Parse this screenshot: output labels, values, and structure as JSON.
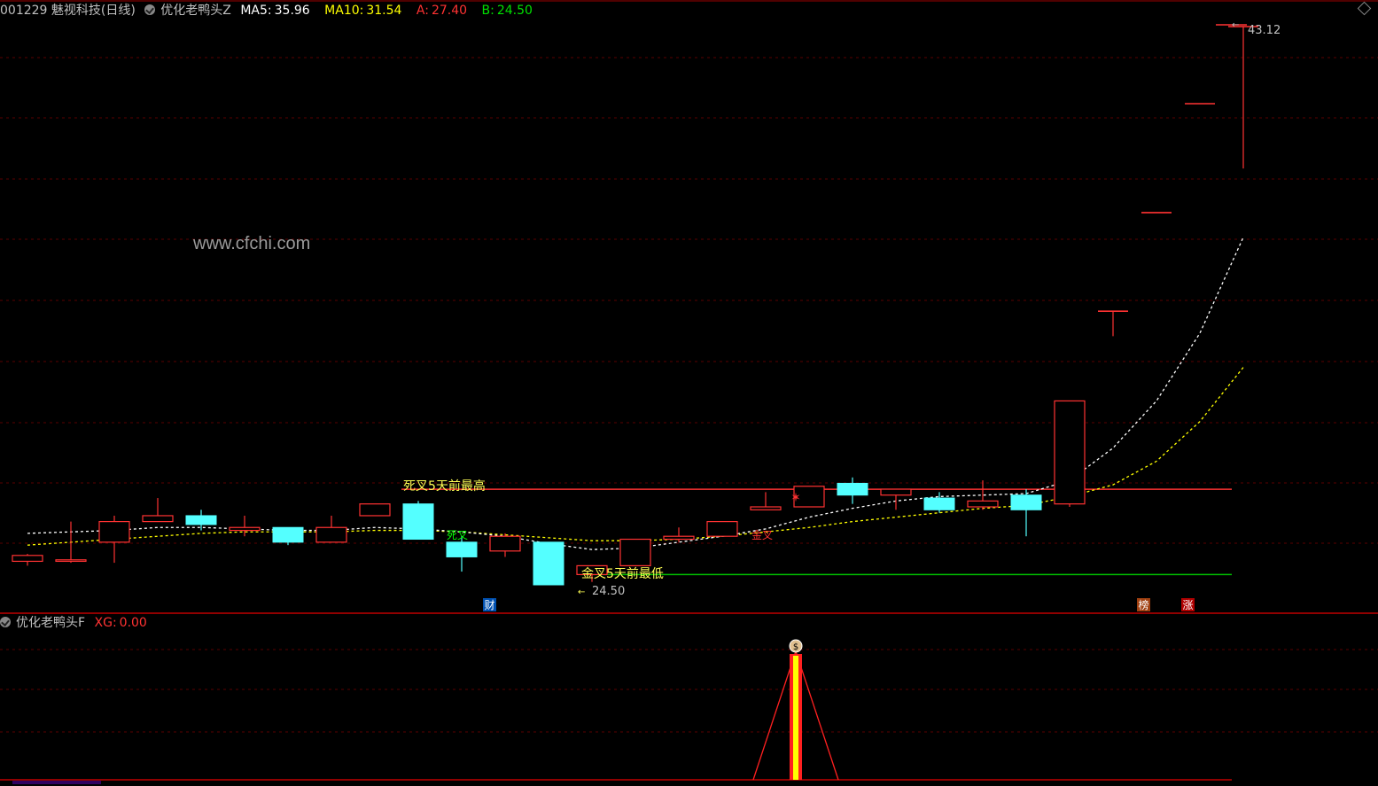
{
  "header": {
    "code_name": "001229 魅视科技",
    "period": "(日线)",
    "indicator": "优化老鸭头Z",
    "ma5_label": "MA5:",
    "ma5_value": "35.96",
    "ma10_label": "MA10:",
    "ma10_value": "31.54",
    "a_label": "A:",
    "a_value": "27.40",
    "b_label": "B:",
    "b_value": "24.50"
  },
  "sub_header": {
    "indicator": "优化老鸭头F",
    "xg_label": "XG:",
    "xg_value": "0.00"
  },
  "watermark": "www.cfchi.com",
  "annotations": {
    "death_cross_high": "死叉5天前最高",
    "golden_cross_low": "金叉5天前最低",
    "death_cross": "死叉",
    "golden_cross": "金叉",
    "low_value": "24.50",
    "high_value": "43.12",
    "badge_cai": "财",
    "badge_bang": "榜",
    "badge_zhang": "涨"
  },
  "colors": {
    "up": "#ff3232",
    "down": "#54ffff",
    "ma5": "#ffffff",
    "ma10": "#ffff00",
    "grid": "#5a0000",
    "line_a": "#ff3232",
    "line_b": "#00c000",
    "text_yellow": "#ffff54",
    "text_green": "#00ff00"
  },
  "chart_data": {
    "type": "candlestick",
    "level_a": 27.4,
    "level_b": 24.5,
    "candles": [
      {
        "o": 24.95,
        "c": 25.15,
        "h": 25.2,
        "l": 24.8
      },
      {
        "o": 24.95,
        "c": 25.0,
        "h": 26.3,
        "l": 24.9
      },
      {
        "o": 25.6,
        "c": 26.3,
        "h": 26.5,
        "l": 24.9
      },
      {
        "o": 26.3,
        "c": 26.5,
        "h": 27.1,
        "l": 26.3
      },
      {
        "o": 26.5,
        "c": 26.2,
        "h": 26.7,
        "l": 26.0
      },
      {
        "o": 26.0,
        "c": 26.1,
        "h": 26.5,
        "l": 25.8
      },
      {
        "o": 26.1,
        "c": 25.6,
        "h": 26.1,
        "l": 25.5
      },
      {
        "o": 25.6,
        "c": 26.1,
        "h": 26.5,
        "l": 25.6
      },
      {
        "o": 26.5,
        "c": 26.9,
        "h": 26.9,
        "l": 26.5
      },
      {
        "o": 26.9,
        "c": 25.7,
        "h": 27.0,
        "l": 25.7
      },
      {
        "o": 25.6,
        "c": 25.1,
        "h": 25.8,
        "l": 24.6
      },
      {
        "o": 25.3,
        "c": 25.8,
        "h": 25.9,
        "l": 25.1
      },
      {
        "o": 25.6,
        "c": 24.15,
        "h": 25.6,
        "l": 24.15
      },
      {
        "o": 24.5,
        "c": 24.8,
        "h": 24.8,
        "l": 24.25
      },
      {
        "o": 24.8,
        "c": 25.7,
        "h": 25.7,
        "l": 24.8
      },
      {
        "o": 25.7,
        "c": 25.8,
        "h": 26.1,
        "l": 25.6
      },
      {
        "o": 25.8,
        "c": 26.3,
        "h": 26.3,
        "l": 25.8
      },
      {
        "o": 26.7,
        "c": 26.8,
        "h": 27.3,
        "l": 26.7
      },
      {
        "o": 26.8,
        "c": 27.5,
        "h": 27.5,
        "l": 26.8
      },
      {
        "o": 27.6,
        "c": 27.2,
        "h": 27.8,
        "l": 26.9
      },
      {
        "o": 27.2,
        "c": 27.4,
        "h": 27.4,
        "l": 26.7
      },
      {
        "o": 27.1,
        "c": 26.7,
        "h": 27.3,
        "l": 26.6
      },
      {
        "o": 26.8,
        "c": 27.0,
        "h": 27.7,
        "l": 26.7
      },
      {
        "o": 27.2,
        "c": 26.7,
        "h": 27.4,
        "l": 25.8
      },
      {
        "o": 26.9,
        "c": 30.4,
        "h": 30.4,
        "l": 26.8
      },
      {
        "o": 33.45,
        "c": 33.45,
        "h": 33.45,
        "l": 32.6
      },
      {
        "o": 36.8,
        "c": 36.8,
        "h": 36.8,
        "l": 36.8
      },
      {
        "o": 40.5,
        "c": 40.5,
        "h": 40.5,
        "l": 40.5
      },
      {
        "o": 43.12,
        "c": 43.12,
        "h": 43.12,
        "l": 38.3
      }
    ],
    "ma5": [
      25.9,
      25.95,
      26.0,
      26.1,
      26.1,
      26.05,
      26.0,
      26.0,
      26.1,
      26.05,
      25.95,
      25.8,
      25.55,
      25.35,
      25.4,
      25.6,
      25.8,
      26.05,
      26.45,
      26.75,
      27.0,
      27.15,
      27.2,
      27.25,
      27.7,
      28.8,
      30.4,
      32.7,
      35.96
    ],
    "ma10": [
      25.5,
      25.6,
      25.7,
      25.8,
      25.9,
      25.95,
      25.95,
      25.95,
      26.0,
      26.0,
      25.95,
      25.85,
      25.75,
      25.65,
      25.65,
      25.7,
      25.8,
      25.95,
      26.1,
      26.3,
      26.45,
      26.6,
      26.75,
      26.85,
      27.15,
      27.55,
      28.35,
      29.7,
      31.54
    ],
    "xg_bars": [
      0,
      0,
      0,
      0,
      0,
      0,
      0,
      0,
      0,
      0,
      0,
      0,
      0,
      0,
      0,
      0,
      0,
      0,
      0,
      0,
      0,
      0,
      0,
      0,
      0,
      0,
      0,
      0,
      0
    ]
  }
}
